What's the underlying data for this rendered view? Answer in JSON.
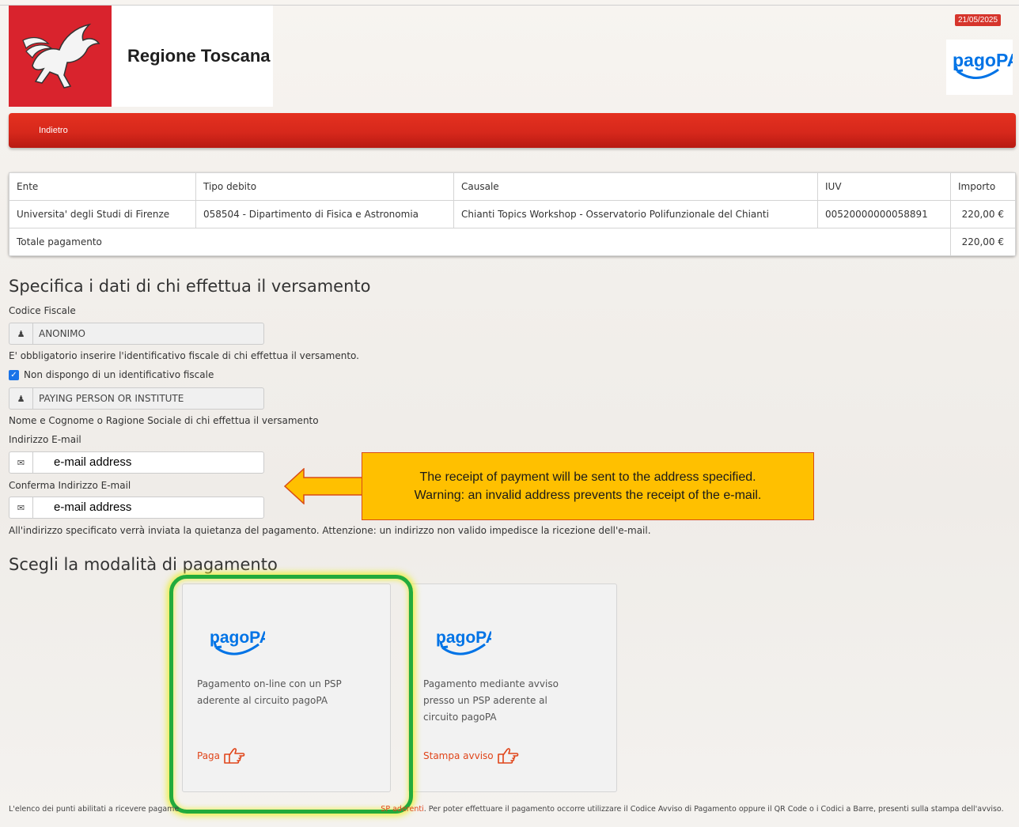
{
  "header": {
    "brand": "Regione Toscana",
    "date": "21/05/2025",
    "logo_icon": "pegasus-icon",
    "pagopa_logo": "pagoPA",
    "accent_color": "#d6352c"
  },
  "nav": {
    "back_label": "Indietro"
  },
  "summary_table": {
    "headers": [
      "Ente",
      "Tipo debito",
      "Causale",
      "IUV",
      "Importo"
    ],
    "row": {
      "ente": "Universita' degli Studi di Firenze",
      "tipo": "058504 - Dipartimento di Fisica e Astronomia",
      "causale": "Chianti Topics Workshop - Osservatorio Polifunzionale del Chianti",
      "iuv": "00520000000058891",
      "importo": "220,00 €"
    },
    "total_label": "Totale pagamento",
    "total_value": "220,00 €"
  },
  "payer": {
    "title": "Specifica i dati di chi effettua il versamento",
    "cf_label": "Codice Fiscale",
    "cf_value": "ANONIMO",
    "cf_help": "E' obbligatorio inserire l'identificativo fiscale di chi effettua il versamento.",
    "no_cf_label": "Non dispongo di un identificativo fiscale",
    "no_cf_checked": true,
    "name_value": "PAYING PERSON OR INSTITUTE",
    "name_help": "Nome e Cognome o Ragione Sociale di chi effettua il versamento",
    "email_label": "Indirizzo E-mail",
    "email_value": "e-mail address",
    "confirm_label": "Conferma Indirizzo E-mail",
    "confirm_value": "e-mail address",
    "email_help": "All'indirizzo specificato verrà inviata la quietanza del pagamento. Attenzione: un indirizzo non valido impedisce la ricezione dell'e-mail."
  },
  "callout": {
    "line1": "The receipt of payment will be sent to the address specified.",
    "line2": "Warning: an invalid address prevents the receipt of the e-mail.",
    "color": "#ffc000"
  },
  "payment": {
    "title": "Scegli la modalità di pagamento",
    "cards": [
      {
        "logo": "pagoPA",
        "desc": "Pagamento on-line con un PSP aderente al circuito pagoPA",
        "action": "Paga"
      },
      {
        "logo": "pagoPA",
        "desc": "Pagamento mediante avviso presso un PSP aderente al circuito pagoPA",
        "action": "Stampa avviso"
      }
    ],
    "highlight_color": "#22ab3c"
  },
  "footer": {
    "text_start": "L'elenco dei punti abilitati a ricevere pagame",
    "text_link": "SP aderenti",
    "text_end": ". Per poter effettuare il pagamento occorre utilizzare il Codice Avviso di Pagamento oppure il QR Code o i Codici a Barre, presenti sulla stampa dell'avviso."
  }
}
